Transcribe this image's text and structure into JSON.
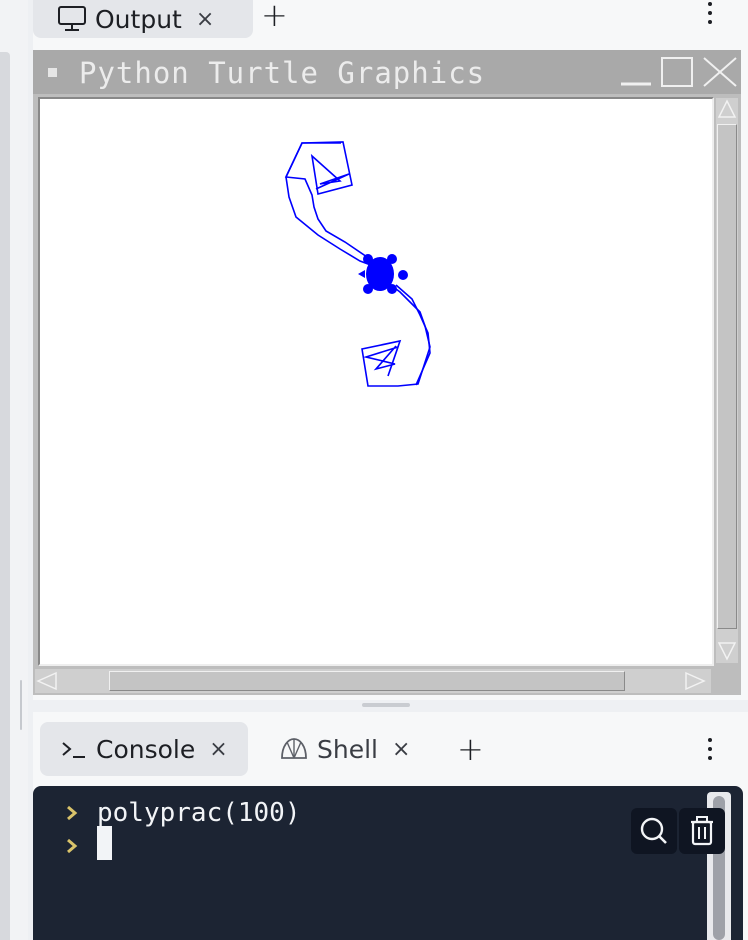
{
  "top_panel": {
    "tabs": [
      {
        "label": "Output",
        "icon": "monitor-icon",
        "close": "×",
        "active": true
      }
    ],
    "add_tab": "+"
  },
  "turtle_window": {
    "title": "Python Turtle Graphics",
    "drawing_color": "#0000ff",
    "background": "#ffffff"
  },
  "bottom_panel": {
    "tabs": [
      {
        "label": "Console",
        "icon": "terminal-icon",
        "close": "×",
        "active": true
      },
      {
        "label": "Shell",
        "icon": "shell-icon",
        "close": "×",
        "active": false
      }
    ],
    "add_tab": "+"
  },
  "console": {
    "lines": [
      {
        "prompt": "prompt-arrow-icon",
        "text": "polyprac(100)"
      },
      {
        "prompt": "prompt-arrow-icon",
        "text": ""
      }
    ],
    "background": "#1c2433",
    "prompt_color": "#d9c36a"
  }
}
